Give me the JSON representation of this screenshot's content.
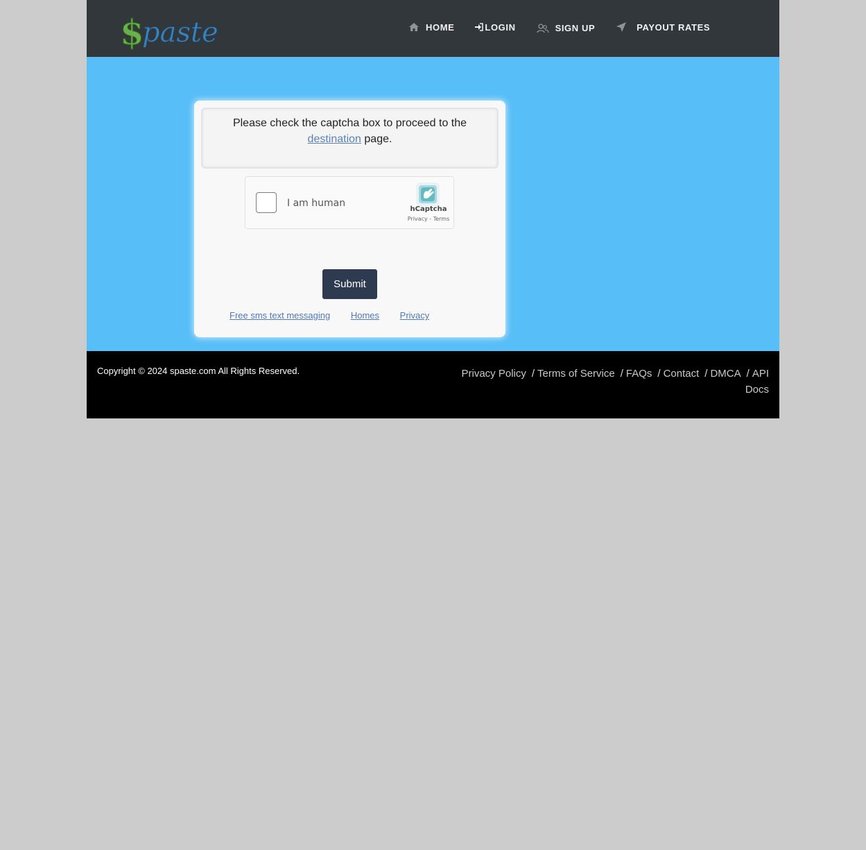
{
  "header": {
    "logo_text": "$paste",
    "nav": [
      {
        "label": "HOME",
        "icon": "home-icon"
      },
      {
        "label": "LOGIN",
        "icon": "login-icon"
      },
      {
        "label": "SIGN UP",
        "icon": "users-icon"
      },
      {
        "label": "PAYOUT RATES",
        "icon": "send-icon"
      }
    ]
  },
  "card": {
    "notice_before": "Please check the captcha box to proceed to the",
    "notice_link": "destination",
    "notice_after": "page.",
    "captcha": {
      "label": "I am human",
      "brand": "hCaptcha",
      "privacy": "Privacy",
      "separator": " - ",
      "terms": "Terms"
    },
    "submit_label": "Submit",
    "links": [
      "Free sms text messaging",
      "Homes",
      "Privacy"
    ]
  },
  "footer": {
    "copyright": "Copyright © 2024 spaste.com All Rights Reserved.",
    "links": [
      "Privacy Policy",
      "Terms of Service",
      "FAQs",
      "Contact",
      "DMCA",
      "API Docs"
    ]
  },
  "colors": {
    "navbar": "#32373b",
    "hero": "#58bef7",
    "submit": "#2e3a4f",
    "footer": "#000000",
    "background": "#cccccc"
  }
}
